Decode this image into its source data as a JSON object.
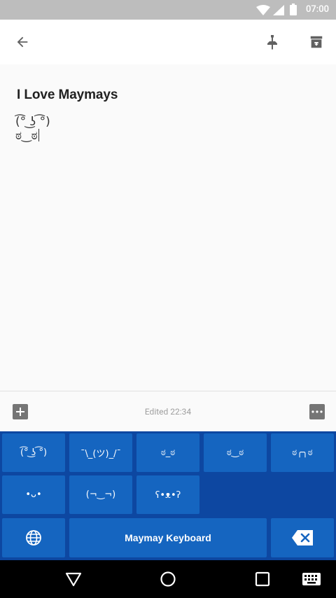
{
  "status_bar": {
    "time": "07:00"
  },
  "toolbar": {},
  "note": {
    "title": "I Love Maymays",
    "body_line1": "(͡° ͜ʖ ͡°)",
    "body_line2": "ಠ‿ಠ"
  },
  "bottom_bar": {
    "edited": "Edited 22:34"
  },
  "keyboard": {
    "row1": [
      "(͡° ͜ʖ ͡°)",
      "¯\\_(ツ)_/¯",
      "ಠ_ಠ",
      "ಠ‿ಠ",
      "ಠ╭╮ಠ"
    ],
    "row2": [
      "•ᴗ•",
      "(¬‿¬)",
      "ʕ•ᴥ•ʔ"
    ],
    "space_label": "Maymay Keyboard"
  },
  "colors": {
    "keyboard_bg": "#0d47a1",
    "key_bg": "#1565c0",
    "status_bar": "#bdbdbd"
  }
}
